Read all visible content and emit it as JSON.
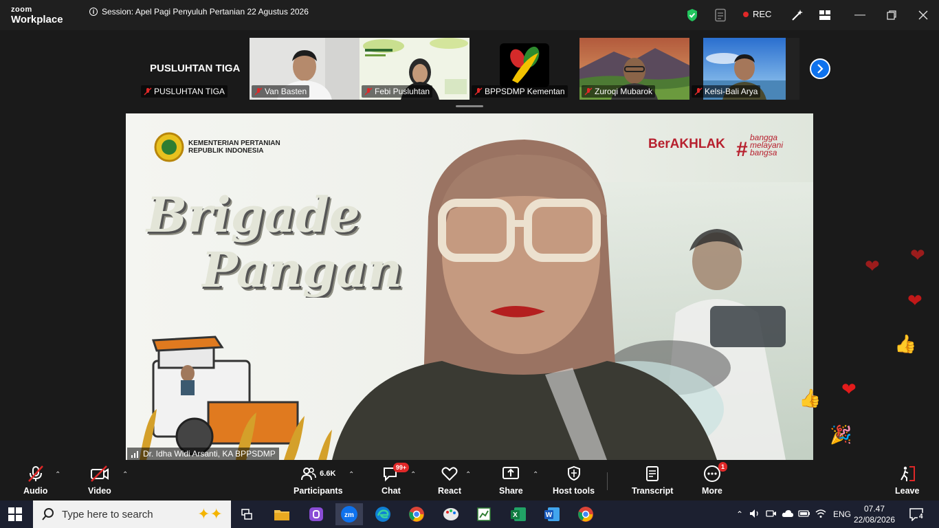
{
  "app": {
    "logo_line1": "zoom",
    "logo_line2": "Workplace"
  },
  "session": {
    "title": "Session: Apel Pagi Penyuluh Pertanian 22 Agustus 2026"
  },
  "recording": {
    "label": "REC"
  },
  "gallery": {
    "active_label": "PUSLUHTAN TIGA",
    "tiles": [
      {
        "name": "PUSLUHTAN TIGA"
      },
      {
        "name": "Van Basten"
      },
      {
        "name": "Febi Pusluhtan"
      },
      {
        "name": "BPPSDMP Kementan"
      },
      {
        "name": "Zuroqi Mubarok"
      },
      {
        "name": "Kelsi-Bali Arya"
      }
    ]
  },
  "slide": {
    "ministry_line1": "KEMENTERIAN PERTANIAN",
    "ministry_line2": "REPUBLIK INDONESIA",
    "brand1": "BerAKHLAK",
    "brand2_line1": "bangga",
    "brand2_line2": "melayani",
    "brand2_line3": "bangsa",
    "headline_line1": "Brigade",
    "headline_line2": "Pangan"
  },
  "speaker": {
    "name": "Dr. Idha Widi Arsanti, KA BPPSDMP"
  },
  "toolbar": {
    "audio": "Audio",
    "video": "Video",
    "participants": "Participants",
    "participants_count": "6.6K",
    "chat": "Chat",
    "chat_badge": "99+",
    "react": "React",
    "share": "Share",
    "host_tools": "Host tools",
    "transcript": "Transcript",
    "more": "More",
    "more_badge": "1",
    "leave": "Leave"
  },
  "taskbar": {
    "search_placeholder": "Type here to search",
    "language": "ENG",
    "time": "07.47",
    "date": "22/08/2026",
    "notifications": "4"
  },
  "colors": {
    "accent": "#0e72ed",
    "danger": "#e02828",
    "shield": "#22c55e"
  }
}
